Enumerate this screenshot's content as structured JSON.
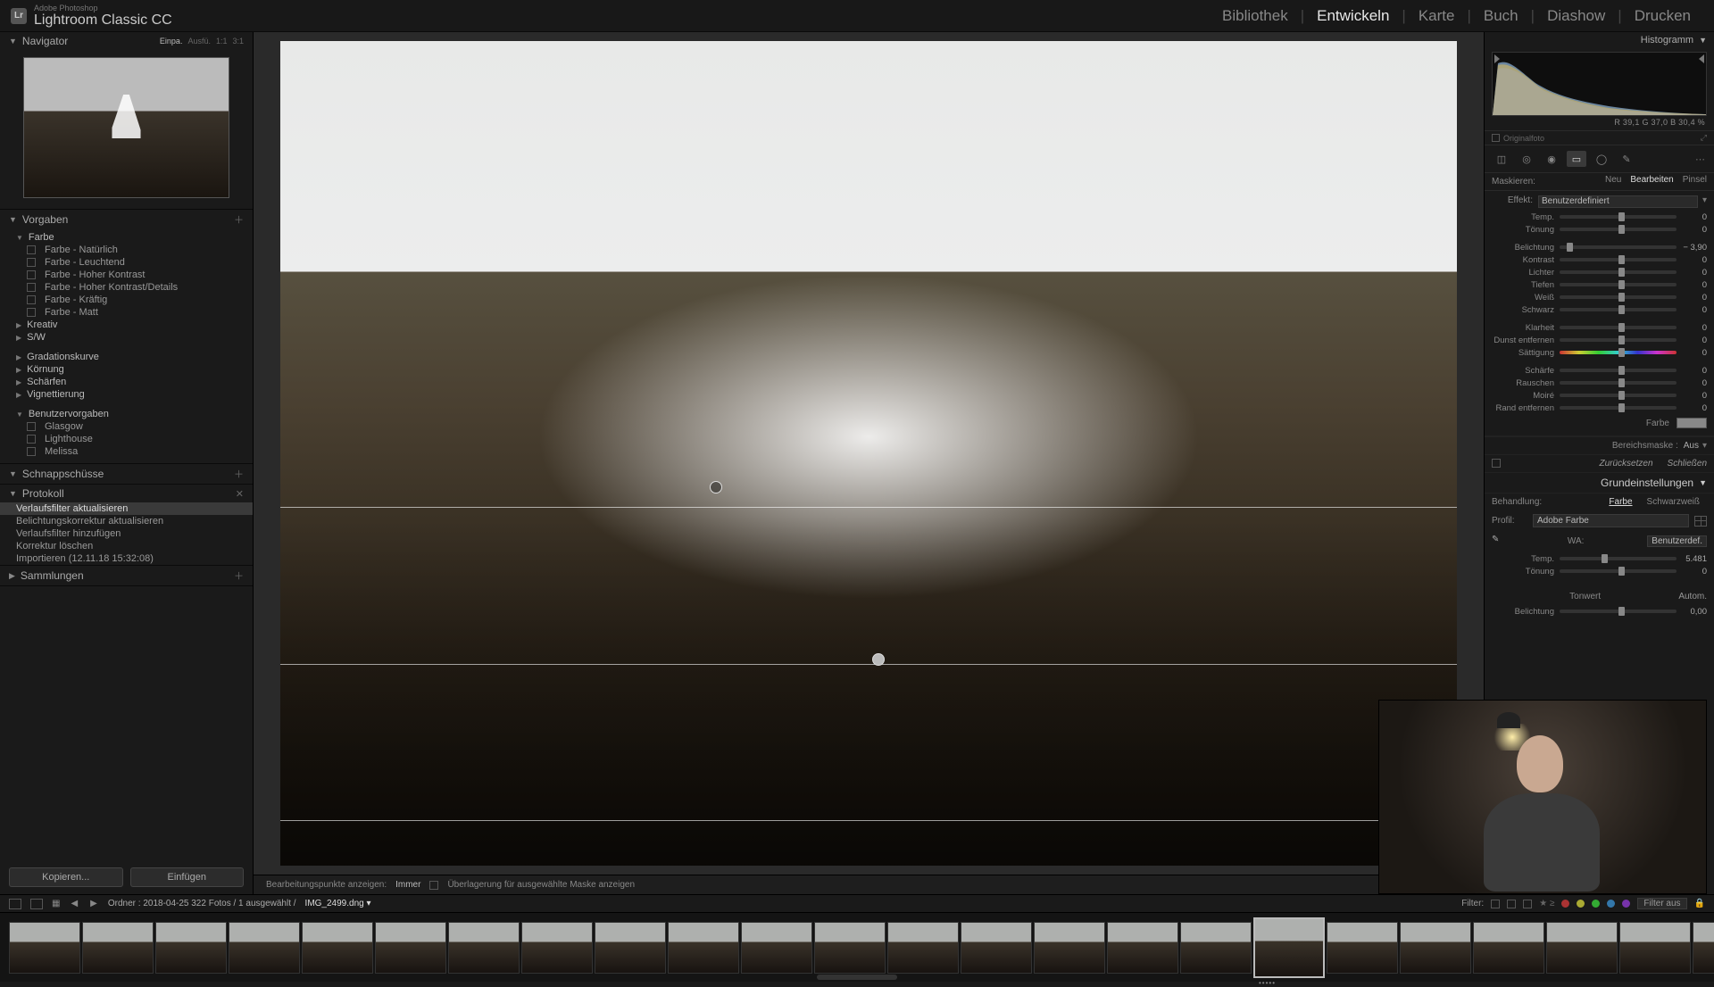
{
  "brand": {
    "sub": "Adobe Photoshop",
    "main": "Lightroom Classic CC",
    "logo": "Lr"
  },
  "modules": [
    "Bibliothek",
    "Entwickeln",
    "Karte",
    "Buch",
    "Diashow",
    "Drucken"
  ],
  "activeModule": 1,
  "navigator": {
    "title": "Navigator",
    "zoomLabels": [
      "Einpa.",
      "Ausfü.",
      "1:1",
      "3:1"
    ]
  },
  "presets": {
    "title": "Vorgaben",
    "groups": [
      {
        "name": "Farbe",
        "open": true,
        "items": [
          "Farbe - Natürlich",
          "Farbe - Leuchtend",
          "Farbe - Hoher Kontrast",
          "Farbe - Hoher Kontrast/Details",
          "Farbe - Kräftig",
          "Farbe - Matt"
        ]
      },
      {
        "name": "Kreativ",
        "open": false,
        "items": []
      },
      {
        "name": "S/W",
        "open": false,
        "items": []
      },
      {
        "name": "Gradationskurve",
        "open": false,
        "items": [],
        "spaced": true
      },
      {
        "name": "Körnung",
        "open": false,
        "items": []
      },
      {
        "name": "Schärfen",
        "open": false,
        "items": []
      },
      {
        "name": "Vignettierung",
        "open": false,
        "items": []
      },
      {
        "name": "Benutzervorgaben",
        "open": true,
        "items": [
          "Glasgow",
          "Lighthouse",
          "Melissa"
        ],
        "spaced": true
      }
    ]
  },
  "snapshots": {
    "title": "Schnappschüsse"
  },
  "history": {
    "title": "Protokoll",
    "items": [
      "Verlaufsfilter aktualisieren",
      "Belichtungskorrektur aktualisieren",
      "Verlaufsfilter hinzufügen",
      "Korrektur löschen",
      "Importieren (12.11.18 15:32:08)"
    ],
    "selected": 0
  },
  "collections": {
    "title": "Sammlungen"
  },
  "leftButtons": {
    "copy": "Kopieren...",
    "paste": "Einfügen"
  },
  "centerToolbar": {
    "editPointsLabel": "Bearbeitungspunkte anzeigen:",
    "editPointsValue": "Immer",
    "overlayLabel": "Überlagerung für ausgewählte Maske anzeigen"
  },
  "rightPanel": {
    "histogram": {
      "title": "Histogramm",
      "readout": "R  39,1   G  37,0   B  30,4  %"
    },
    "original": "Originalfoto",
    "maskTabs": {
      "label": "Maskieren:",
      "tabs": [
        "Neu",
        "Bearbeiten",
        "Pinsel"
      ],
      "active": 1
    },
    "effectLabel": "Effekt:",
    "effectValue": "Benutzerdefiniert",
    "sliders": [
      {
        "lbl": "Temp.",
        "val": "0",
        "pos": 50
      },
      {
        "lbl": "Tönung",
        "val": "0",
        "pos": 50
      },
      {
        "lbl": "Belichtung",
        "val": "− 3,90",
        "pos": 6
      },
      {
        "lbl": "Kontrast",
        "val": "0",
        "pos": 50
      },
      {
        "lbl": "Lichter",
        "val": "0",
        "pos": 50
      },
      {
        "lbl": "Tiefen",
        "val": "0",
        "pos": 50
      },
      {
        "lbl": "Weiß",
        "val": "0",
        "pos": 50
      },
      {
        "lbl": "Schwarz",
        "val": "0",
        "pos": 50
      },
      {
        "lbl": "Klarheit",
        "val": "0",
        "pos": 50
      },
      {
        "lbl": "Dunst entfernen",
        "val": "0",
        "pos": 50
      },
      {
        "lbl": "Sättigung",
        "val": "0",
        "pos": 50,
        "hue": true
      },
      {
        "lbl": "Schärfe",
        "val": "0",
        "pos": 50
      },
      {
        "lbl": "Rauschen",
        "val": "0",
        "pos": 50
      },
      {
        "lbl": "Moiré",
        "val": "0",
        "pos": 50
      },
      {
        "lbl": "Rand entfernen",
        "val": "0",
        "pos": 50
      }
    ],
    "colorLabel": "Farbe",
    "rangeMask": {
      "lbl": "Bereichsmaske :",
      "val": "Aus"
    },
    "actions": {
      "reset": "Zurücksetzen",
      "close": "Schließen"
    },
    "basic": {
      "title": "Grundeinstellungen",
      "treatmentLabel": "Behandlung:",
      "treatColor": "Farbe",
      "treatBW": "Schwarzweiß",
      "profileLabel": "Profil:",
      "profileValue": "Adobe Farbe",
      "wbLabel": "WA:",
      "wbValue": "Benutzerdef.",
      "wbSliders": [
        {
          "lbl": "Temp.",
          "val": "5.481",
          "pos": 36
        },
        {
          "lbl": "Tönung",
          "val": "0",
          "pos": 50
        }
      ],
      "toneLabel": "Tonwert",
      "autoLabel": "Autom.",
      "exposureLabel": "Belichtung",
      "exposureVal": "0,00"
    }
  },
  "secondaryBar": {
    "folderInfo": "Ordner : 2018-04-25   322 Fotos / 1 ausgewählt /",
    "filename": "IMG_2499.dng",
    "filterLabel": "Filter:",
    "filterOff": "Filter aus"
  },
  "filmstrip": {
    "count": 24,
    "selected": 17
  }
}
